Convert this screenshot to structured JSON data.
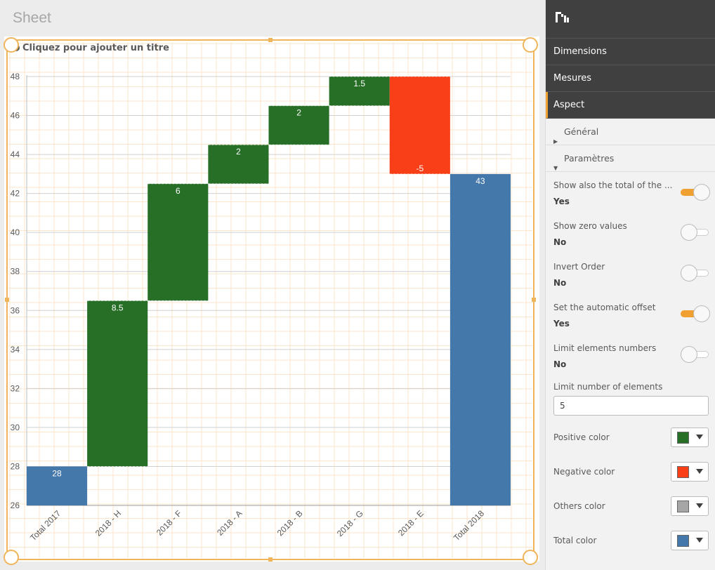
{
  "sheet": {
    "title": "Sheet"
  },
  "chart": {
    "title_placeholder": "Cliquez pour ajouter un titre"
  },
  "chart_data": {
    "type": "bar",
    "subtype": "waterfall",
    "categories": [
      "Total 2017",
      "2018 - H",
      "2018 - F",
      "2018 - A",
      "2018 - B",
      "2018 - G",
      "2018 - E",
      "Total 2018"
    ],
    "values": [
      28,
      8.5,
      6,
      2,
      2,
      1.5,
      -5,
      43
    ],
    "labels": [
      "28",
      "8.5",
      "6",
      "2",
      "2",
      "1.5",
      "-5",
      "43"
    ],
    "kinds": [
      "total",
      "positive",
      "positive",
      "positive",
      "positive",
      "positive",
      "negative",
      "total"
    ],
    "ylim": [
      26,
      48
    ],
    "yticks": [
      26,
      28,
      30,
      32,
      34,
      36,
      38,
      40,
      42,
      44,
      46,
      48
    ],
    "colors": {
      "positive": "#276e27",
      "negative": "#f93f17",
      "total": "#4477aa"
    },
    "grid": true
  },
  "panel": {
    "tabs": [
      {
        "label": "Dimensions"
      },
      {
        "label": "Mesures"
      },
      {
        "label": "Aspect"
      }
    ],
    "sections": [
      {
        "label": "Général",
        "expanded": false
      },
      {
        "label": "Paramètres",
        "expanded": true
      }
    ],
    "settings": [
      {
        "label": "Show also the total of the ...",
        "value": "Yes",
        "on": true
      },
      {
        "label": "Show zero values",
        "value": "No",
        "on": false
      },
      {
        "label": "Invert Order",
        "value": "No",
        "on": false
      },
      {
        "label": "Set the automatic offset",
        "value": "Yes",
        "on": true
      },
      {
        "label": "Limit elements numbers",
        "value": "No",
        "on": false
      }
    ],
    "limit_field": {
      "label": "Limit number of elements",
      "value": "5"
    },
    "color_settings": [
      {
        "label": "Positive color",
        "color": "#276e27"
      },
      {
        "label": "Negative color",
        "color": "#f93f17"
      },
      {
        "label": "Others color",
        "color": "#a6a6a6"
      },
      {
        "label": "Total color",
        "color": "#4477aa"
      }
    ]
  }
}
